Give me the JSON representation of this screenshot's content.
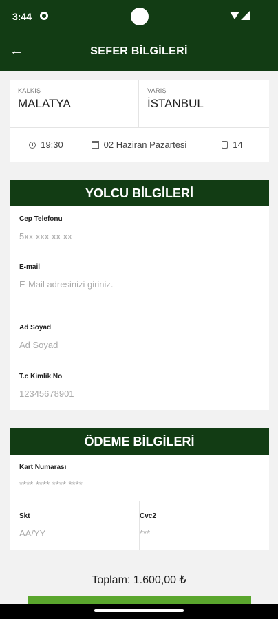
{
  "status_bar": {
    "time": "3:44"
  },
  "app_bar": {
    "back_icon": "←",
    "title": "SEFER BİLGİLERİ"
  },
  "trip": {
    "departure_label": "KALKIŞ",
    "departure_city": "MALATYA",
    "arrival_label": "VARIŞ",
    "arrival_city": "İSTANBUL",
    "time": "19:30",
    "date": "02 Haziran Pazartesi",
    "seat": "14"
  },
  "passenger": {
    "heading": "YOLCU BİLGİLERİ",
    "phone_label": "Cep Telefonu",
    "phone_placeholder": "5xx xxx xx xx",
    "email_label": "E-mail",
    "email_placeholder": "E-Mail adresinizi giriniz.",
    "name_label": "Ad Soyad",
    "name_placeholder": "Ad Soyad",
    "tc_label": "T.c Kimlik No",
    "tc_placeholder": "12345678901"
  },
  "payment": {
    "heading": "ÖDEME BİLGİLERİ",
    "card_label": "Kart Numarası",
    "card_placeholder": "**** **** **** ****",
    "expiry_label": "Skt",
    "expiry_placeholder": "AA/YY",
    "cvc_label": "Cvc2",
    "cvc_placeholder": "***"
  },
  "total": "Toplam: 1.600,00 ₺",
  "colors": {
    "primary": "#123c14",
    "button": "#5aa62d",
    "background": "#f2f2f2"
  }
}
